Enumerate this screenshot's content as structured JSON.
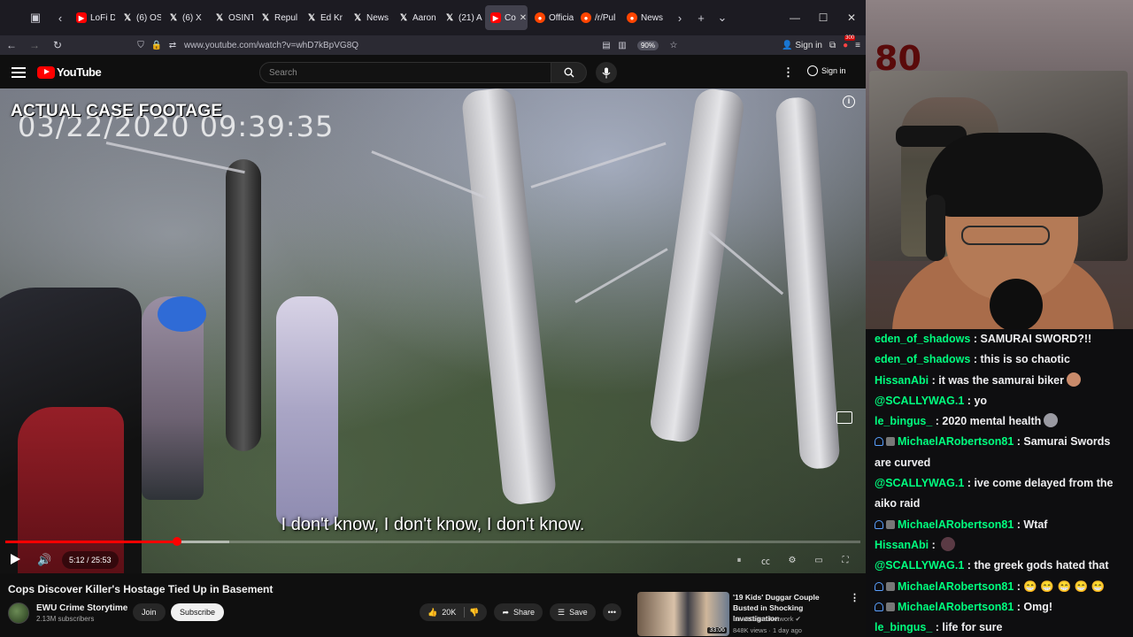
{
  "browser": {
    "tabs": [
      {
        "label": "LoFi D",
        "favicon": "youtube-icon"
      },
      {
        "label": "(6) OS",
        "favicon": "x-icon"
      },
      {
        "label": "(6) X",
        "favicon": "x-icon"
      },
      {
        "label": "OSINT",
        "favicon": "x-icon"
      },
      {
        "label": "Repul",
        "favicon": "x-icon"
      },
      {
        "label": "Ed Kr",
        "favicon": "x-icon"
      },
      {
        "label": "News",
        "favicon": "x-icon"
      },
      {
        "label": "Aaron",
        "favicon": "x-icon"
      },
      {
        "label": "(21) A",
        "favicon": "x-icon"
      },
      {
        "label": "Co",
        "favicon": "youtube-icon",
        "active": true
      },
      {
        "label": "Officia",
        "favicon": "reddit-icon"
      },
      {
        "label": "/r/Pul",
        "favicon": "reddit-icon"
      },
      {
        "label": "News",
        "favicon": "reddit-icon"
      }
    ],
    "url": "www.youtube.com/watch?v=whD7kBpVG8Q",
    "zoom": "90%",
    "sign_in": "Sign in",
    "extension_badge": "300"
  },
  "youtube": {
    "logo_text": "YouTube",
    "search_placeholder": "Search",
    "sign_in": "Sign in"
  },
  "video": {
    "overlay_label": "ACTUAL CASE FOOTAGE",
    "timestamp": "03/22/2020 09:39:35",
    "subtitle": "I don't know, I don't know, I don't know.",
    "current_time": "5:12",
    "duration": "25:53",
    "time_display": "5:12 / 25:53",
    "progress": 0.201,
    "buffered": 0.262,
    "title": "Cops Discover Killer's Hostage Tied Up in Basement"
  },
  "channel": {
    "name": "EWU Crime Storytime",
    "subscribers": "2.13M subscribers",
    "join": "Join",
    "subscribe": "Subscribe"
  },
  "actions": {
    "likes": "20K",
    "share": "Share",
    "save": "Save"
  },
  "recommended": {
    "title": "'19 Kids' Duggar Couple Busted in Shocking Investigation",
    "channel": "Law&Crime Network",
    "meta": "848K views · 1 day ago",
    "duration": "33:06"
  },
  "stream": {
    "wall_sign": "80"
  },
  "chat": [
    {
      "user": "eden_of_shadows",
      "text": "SAMURAI SWORD?!!",
      "badges": false
    },
    {
      "user": "eden_of_shadows",
      "text": "this is so chaotic",
      "badges": false
    },
    {
      "user": "HissanAbi",
      "text": "it was the samurai biker",
      "badges": false,
      "emote": "#c98a6a"
    },
    {
      "user": "@SCALLYWAG.1",
      "text": "yo",
      "badges": false
    },
    {
      "user": "le_bingus_",
      "text": "2020 mental health",
      "badges": false,
      "emote": "#9a9aa2"
    },
    {
      "user": "MichaelARobertson81",
      "text": "Samurai Swords are curved",
      "badges": true
    },
    {
      "user": "@SCALLYWAG.1",
      "text": "ive come delayed from the aiko raid",
      "badges": false
    },
    {
      "user": "MichaelARobertson81",
      "text": "Wtaf",
      "badges": true
    },
    {
      "user": "HissanAbi",
      "text": "",
      "badges": false,
      "emote": "#5a3a44"
    },
    {
      "user": "@SCALLYWAG.1",
      "text": "the greek gods hated that",
      "badges": false
    },
    {
      "user": "MichaelARobertson81",
      "text": "😁 😁 😁 😁 😁",
      "badges": true
    },
    {
      "user": "MichaelARobertson81",
      "text": "Omg!",
      "badges": true
    },
    {
      "user": "le_bingus_",
      "text": "life for sure",
      "badges": false
    }
  ],
  "colors": {
    "chat_username": "#00ff7f",
    "progress": "#ff0000"
  }
}
